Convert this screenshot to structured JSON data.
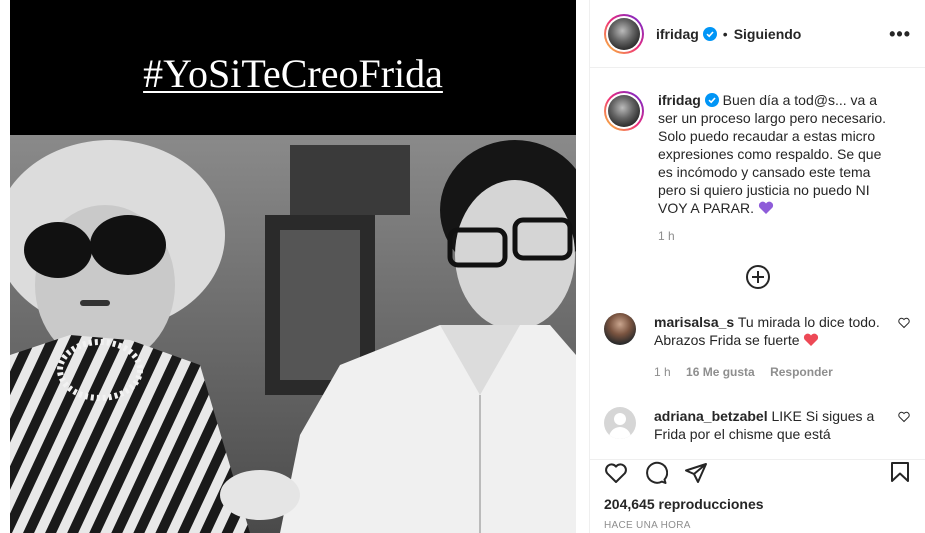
{
  "media": {
    "title_text": "#YoSiTeCreoFrida"
  },
  "header": {
    "username": "ifridag",
    "separator": "•",
    "follow_status": "Siguiendo",
    "more_label": "•••"
  },
  "caption": {
    "username": "ifridag",
    "text": "Buen día a tod@s... va a ser un proceso largo pero necesario. Solo puedo recaudar a estas micro expresiones como respaldo. Se que es incómodo y cansado este tema pero si quiero justicia no puedo NI VOY A PARAR.",
    "time": "1 h"
  },
  "comments": [
    {
      "username": "marisalsa_s",
      "text": "Tu mirada lo dice todo. Abrazos Frida se fuerte",
      "time": "1 h",
      "likes": "16 Me gusta",
      "reply": "Responder"
    },
    {
      "username": "adriana_betzabel",
      "text": "LIKE Si sigues a Frida por el chisme que está",
      "time": "",
      "likes": "",
      "reply": ""
    }
  ],
  "stats": {
    "views": "204,645 reproducciones",
    "posted": "HACE UNA HORA"
  },
  "colors": {
    "verified_blue": "#0095f6",
    "heart_red": "#ed4956",
    "purple_heart": "#8e5cd9"
  }
}
